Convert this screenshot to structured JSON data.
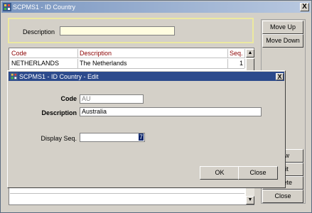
{
  "main_window": {
    "title": "SCPMS1 - ID Country",
    "close_glyph": "X",
    "filter": {
      "description_label": "Description",
      "description_value": ""
    },
    "side_buttons": [
      {
        "key": "move-up",
        "label": "Move Up"
      },
      {
        "key": "move-down",
        "label": "Move Down"
      },
      {
        "key": "new",
        "label": "New"
      },
      {
        "key": "edit",
        "label": "Edit"
      },
      {
        "key": "delete",
        "label": "Delete"
      },
      {
        "key": "close",
        "label": "Close"
      }
    ],
    "grid": {
      "columns": [
        "Code",
        "Description",
        "Seq."
      ],
      "rows": [
        {
          "code": "NETHERLANDS",
          "description": "The Netherlands",
          "seq": "1"
        }
      ]
    }
  },
  "dialog": {
    "title": "SCPMS1 - ID Country - Edit",
    "close_glyph": "X",
    "code_label": "Code",
    "code_value": "AU",
    "description_label": "Description",
    "description_value": "Australia",
    "display_seq_label": "Display Seq.",
    "display_seq_value": "7",
    "ok_label": "OK",
    "close_label": "Close"
  }
}
